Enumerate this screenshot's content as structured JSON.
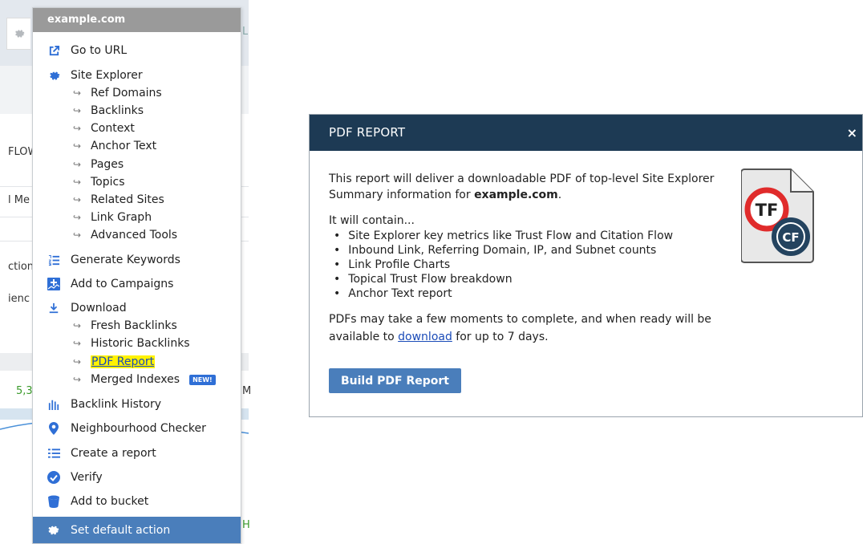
{
  "background": {
    "fragments": [
      "FLOW",
      "l Me",
      "ction",
      "ienc",
      "5,3",
      "M",
      "H",
      "L"
    ]
  },
  "menu": {
    "title": "example.com",
    "items": [
      {
        "label": "Go to URL",
        "icon": "external-link-icon"
      },
      {
        "label": "Site Explorer",
        "icon": "gear-cog-icon",
        "subitems": [
          "Ref Domains",
          "Backlinks",
          "Context",
          "Anchor Text",
          "Pages",
          "Topics",
          "Related Sites",
          "Link Graph",
          "Advanced Tools"
        ]
      },
      {
        "label": "Generate Keywords",
        "icon": "list-number-icon"
      },
      {
        "label": "Add to Campaigns",
        "icon": "add-chart-icon"
      },
      {
        "label": "Download",
        "icon": "download-icon",
        "subitems": [
          "Fresh Backlinks",
          "Historic Backlinks",
          "PDF Report",
          "Merged Indexes"
        ]
      },
      {
        "label": "Backlink History",
        "icon": "bar-chart-icon"
      },
      {
        "label": "Neighbourhood Checker",
        "icon": "map-pin-icon"
      },
      {
        "label": "Create a report",
        "icon": "list-icon"
      },
      {
        "label": "Verify",
        "icon": "check-circle-icon"
      },
      {
        "label": "Add to bucket",
        "icon": "bucket-icon"
      }
    ],
    "new_badge": "NEW!",
    "footer": "Set default action"
  },
  "modal": {
    "title": "PDF REPORT",
    "close": "×",
    "intro_1": "This report will deliver a downloadable PDF of top-level Site Explorer Summary information for ",
    "intro_domain": "example.com",
    "intro_end": ".",
    "contains": "It will contain...",
    "bullets": [
      "Site Explorer key metrics like Trust Flow and Citation Flow",
      "Inbound Link, Referring Domain, IP, and Subnet counts",
      "Link Profile Charts",
      "Topical Trust Flow breakdown",
      "Anchor Text report"
    ],
    "note_1": "PDFs may take a few moments to complete, and when ready will be available to ",
    "note_link": "download",
    "note_2": " for up to 7 days.",
    "button": "Build PDF Report",
    "icon_tf": "TF",
    "icon_cf": "CF"
  },
  "colors": {
    "modal_header": "#1d3a54",
    "button": "#4a7ebb",
    "highlight": "#fff200",
    "tf_ring": "#e02b2b",
    "cf_ring": "#24435f"
  }
}
